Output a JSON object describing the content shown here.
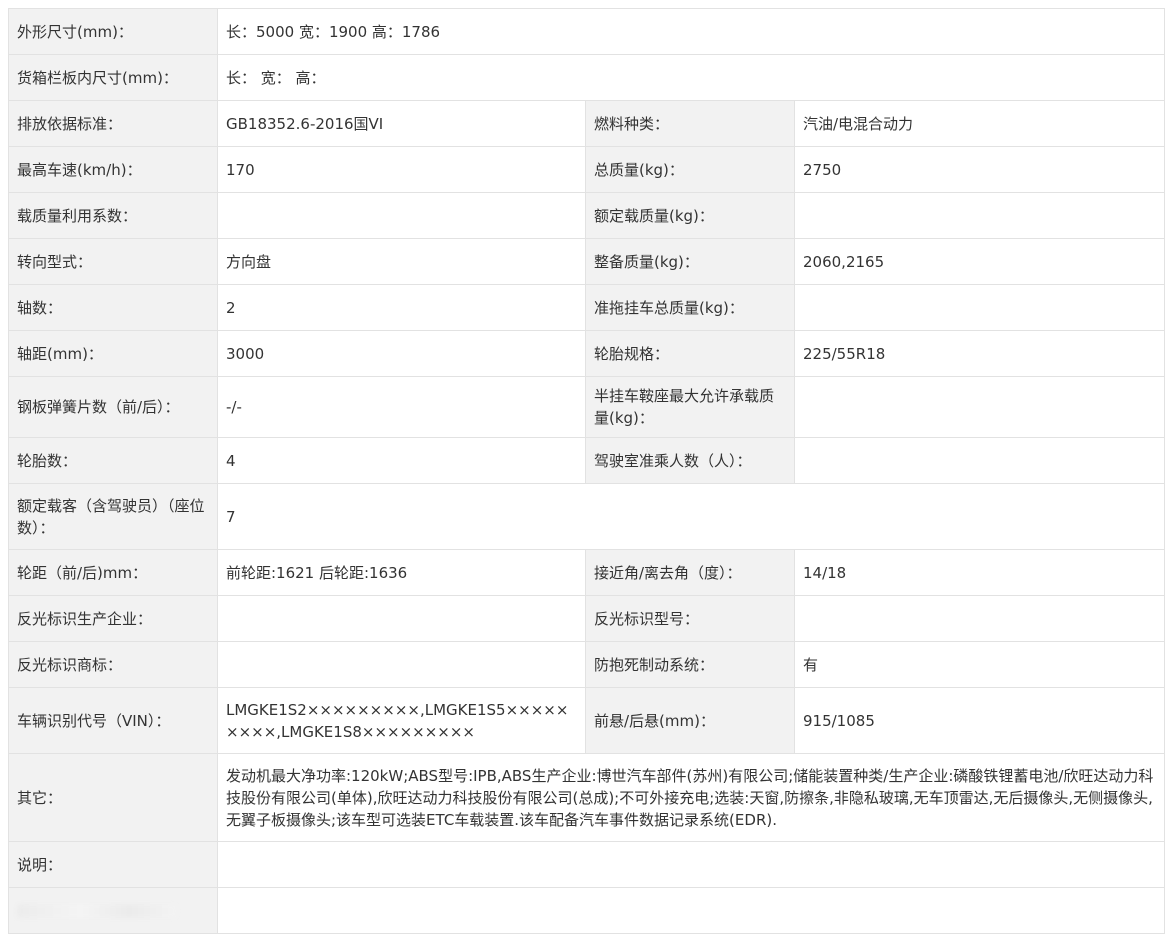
{
  "rows": [
    {
      "l1": "外形尺寸(mm)：",
      "v1": "长：5000 宽：1900 高：1786"
    },
    {
      "l1": "货箱栏板内尺寸(mm)：",
      "v1": "长： 宽： 高："
    },
    {
      "l1": "排放依据标准：",
      "v1": "GB18352.6-2016国VI",
      "l2": "燃料种类：",
      "v2": "汽油/电混合动力"
    },
    {
      "l1": "最高车速(km/h)：",
      "v1": "170",
      "l2": "总质量(kg)：",
      "v2": "2750"
    },
    {
      "l1": "载质量利用系数：",
      "v1": "",
      "l2": "额定载质量(kg)：",
      "v2": ""
    },
    {
      "l1": "转向型式：",
      "v1": "方向盘",
      "l2": "整备质量(kg)：",
      "v2": "2060,2165"
    },
    {
      "l1": "轴数：",
      "v1": "2",
      "l2": "准拖挂车总质量(kg)：",
      "v2": ""
    },
    {
      "l1": "轴距(mm)：",
      "v1": "3000",
      "l2": "轮胎规格：",
      "v2": "225/55R18"
    },
    {
      "l1": "钢板弹簧片数（前/后）：",
      "v1": "-/-",
      "l2": "半挂车鞍座最大允许承载质量(kg)：",
      "v2": ""
    },
    {
      "l1": "轮胎数：",
      "v1": "4",
      "l2": "驾驶室准乘人数（人）：",
      "v2": ""
    },
    {
      "l1": "额定载客（含驾驶员）（座位数）：",
      "v1": "7"
    },
    {
      "l1": "轮距（前/后)mm：",
      "v1": "前轮距:1621 后轮距:1636",
      "l2": "接近角/离去角（度）：",
      "v2": "14/18"
    },
    {
      "l1": "反光标识生产企业：",
      "v1": "",
      "l2": "反光标识型号：",
      "v2": ""
    },
    {
      "l1": "反光标识商标：",
      "v1": "",
      "l2": "防抱死制动系统：",
      "v2": "有"
    },
    {
      "l1": "车辆识别代号（VIN）：",
      "v1": "LMGKE1S2×××××××××,LMGKE1S5×××××××××,LMGKE1S8×××××××××",
      "l2": "前悬/后悬(mm)：",
      "v2": "915/1085"
    },
    {
      "l1": "其它：",
      "v1": "发动机最大净功率:120kW;ABS型号:IPB,ABS生产企业:博世汽车部件(苏州)有限公司;储能装置种类/生产企业:磷酸铁锂蓄电池/欣旺达动力科技股份有限公司(单体),欣旺达动力科技股份有限公司(总成);不可外接充电;选装:天窗,防擦条,非隐私玻璃,无车顶雷达,无后摄像头,无侧摄像头,无翼子板摄像头;该车型可选装ETC车载装置.该车配备汽车事件数据记录系统(EDR)."
    },
    {
      "l1": "说明：",
      "v1": ""
    },
    {
      "l1": "",
      "v1": ""
    }
  ]
}
